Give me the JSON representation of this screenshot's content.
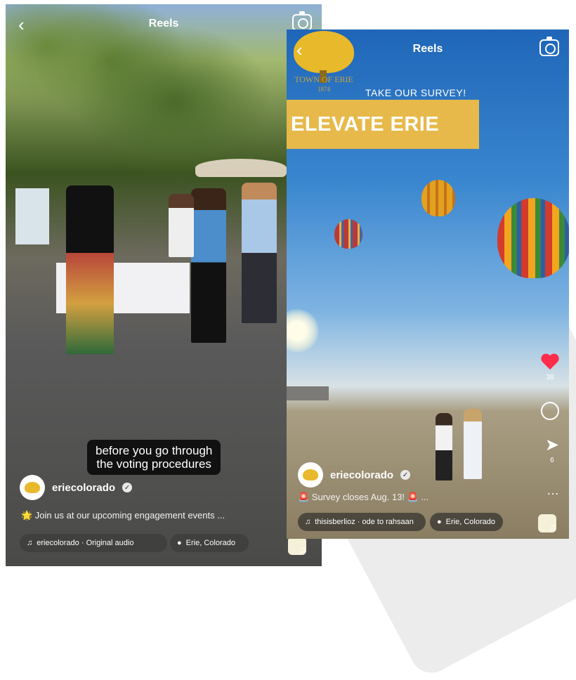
{
  "left": {
    "title": "Reels",
    "caption": [
      "before you go through",
      "the voting procedures"
    ],
    "username": "eriecolorado",
    "description": "🌟 Join us at our upcoming engagement events ...",
    "audio": "eriecolorado · Original audio",
    "location": "Erie, Colorado"
  },
  "right": {
    "title": "Reels",
    "logo_text": "TOWN OF ERIE",
    "logo_year": "1874",
    "survey_text": "TAKE OUR SURVEY!",
    "headline": "ELEVATE ERIE",
    "likes": "38",
    "shares": "6",
    "username": "eriecolorado",
    "description": "🚨 Survey closes Aug. 13! 🚨 ...",
    "audio": "thisisberlioz · ode to rahsaan",
    "location": "Erie, Colorado"
  },
  "colors": {
    "accent": "#e6b94a",
    "like": "#ff2d4a"
  }
}
